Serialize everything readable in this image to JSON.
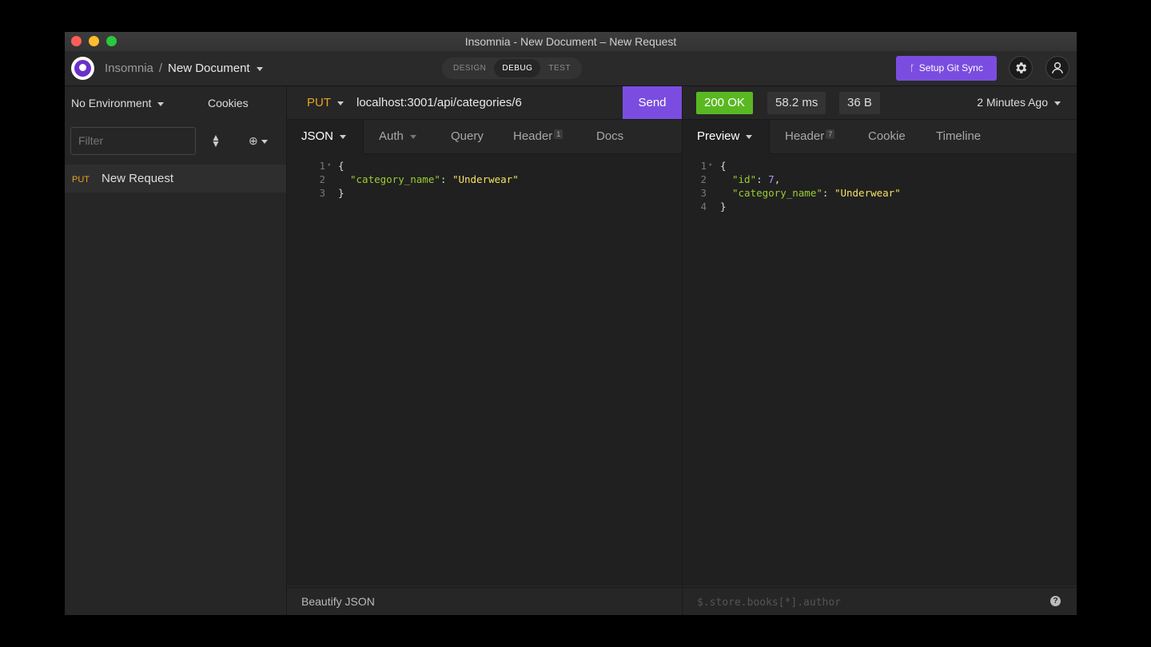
{
  "window": {
    "title": "Insomnia - New Document – New Request"
  },
  "header": {
    "app_name": "Insomnia",
    "separator": "/",
    "document_name": "New Document",
    "modes": [
      "DESIGN",
      "DEBUG",
      "TEST"
    ],
    "active_mode": "DEBUG",
    "git_sync_label": "Setup Git Sync",
    "accent_color": "#7a4de0"
  },
  "sidebar": {
    "environment": "No Environment",
    "cookies": "Cookies",
    "filter_placeholder": "Filter",
    "requests": [
      {
        "method": "PUT",
        "name": "New Request"
      }
    ]
  },
  "request": {
    "method": "PUT",
    "url": "localhost:3001/api/categories/6",
    "send_label": "Send",
    "tabs": {
      "body": "JSON",
      "auth": "Auth",
      "query": "Query",
      "header": "Header",
      "header_count": "1",
      "docs": "Docs"
    },
    "body_lines": [
      "1",
      "2",
      "3"
    ],
    "body": {
      "key": "\"category_name\"",
      "value": "\"Underwear\""
    },
    "footer": "Beautify JSON"
  },
  "response": {
    "status": "200 OK",
    "status_color": "#59b822",
    "time": "58.2 ms",
    "size": "36 B",
    "age": "2 Minutes Ago",
    "tabs": {
      "preview": "Preview",
      "header": "Header",
      "header_count": "7",
      "cookie": "Cookie",
      "timeline": "Timeline"
    },
    "body_lines": [
      "1",
      "2",
      "3",
      "4"
    ],
    "body": {
      "id_key": "\"id\"",
      "id_value": "7",
      "key": "\"category_name\"",
      "value": "\"Underwear\""
    },
    "filter_placeholder": "$.store.books[*].author",
    "help": "?"
  }
}
